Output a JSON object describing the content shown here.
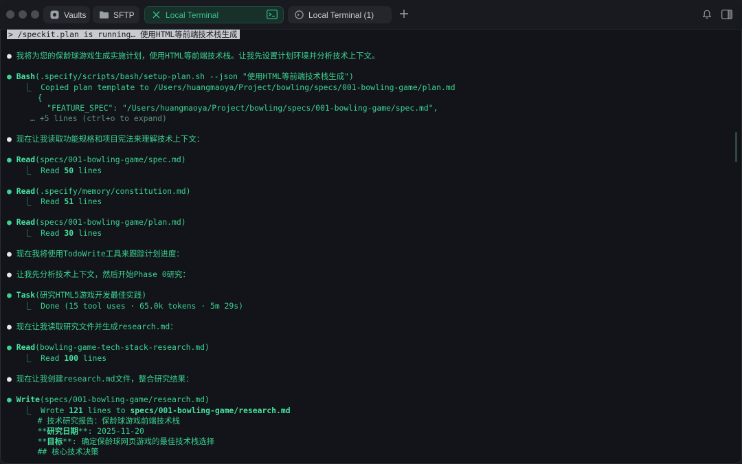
{
  "tabs": [
    {
      "label": "Vaults",
      "icon": "vault-icon"
    },
    {
      "label": "SFTP",
      "icon": "folder-icon"
    },
    {
      "label": "Local Terminal",
      "icon": "close-icon",
      "active": true
    },
    {
      "label": "Local Terminal (1)",
      "icon": "terminal-icon"
    }
  ],
  "terminal": {
    "prompt": "> /speckit.plan is running… 使用HTML等前端技术栈生成",
    "bullet": "●",
    "l1": "我将为您的保龄球游戏生成实施计划，使用HTML等前端技术栈。让我先设置计划环境并分析技术上下文。",
    "bash_name": "Bash",
    "bash_args": "(.specify/scripts/bash/setup-plan.sh --json \"使用HTML等前端技术栈生成\")",
    "bash_out1": "⎿  Copied plan template to /Users/huangmaoya/Project/bowling/specs/001-bowling-game/plan.md",
    "bash_out2": "   {",
    "bash_out3": "     \"FEATURE_SPEC\": \"/Users/huangmaoya/Project/bowling/specs/001-bowling-game/spec.md\",",
    "bash_out4": "… +5 lines (ctrl+o to expand)",
    "l2": "现在让我读取功能规格和项目宪法来理解技术上下文：",
    "read1_name": "Read",
    "read1_args": "(specs/001-bowling-game/spec.md)",
    "read1_pre": "⎿  Read ",
    "read1_count": "50",
    "read1_post": " lines",
    "read2_name": "Read",
    "read2_args": "(.specify/memory/constitution.md)",
    "read2_pre": "⎿  Read ",
    "read2_count": "51",
    "read2_post": " lines",
    "read3_name": "Read",
    "read3_args": "(specs/001-bowling-game/plan.md)",
    "read3_pre": "⎿  Read ",
    "read3_count": "30",
    "read3_post": " lines",
    "l3": "现在我将使用TodoWrite工具来跟踪计划进度：",
    "l4": "让我先分析技术上下文，然后开始Phase 0研究：",
    "task_name": "Task",
    "task_args": "(研究HTML5游戏开发最佳实践)",
    "task_out": "⎿  Done (15 tool uses · 65.0k tokens · 5m 29s)",
    "l5": "现在让我读取研究文件并生成research.md：",
    "read4_name": "Read",
    "read4_args": "(bowling-game-tech-stack-research.md)",
    "read4_pre": "⎿  Read ",
    "read4_count": "100",
    "read4_post": " lines",
    "l6": "现在让我创建research.md文件，整合研究结果：",
    "write_name": "Write",
    "write_args": "(specs/001-bowling-game/research.md)",
    "write_pre": "⎿  Wrote ",
    "write_count": "121",
    "write_mid": " lines to ",
    "write_path": "specs/001-bowling-game/research.md",
    "w1": "   # 技术研究报告：保龄球游戏前端技术栈",
    "w2a": "   **",
    "w2b": "研究日期",
    "w2c": "**: 2025-11-20",
    "w3a": "   **",
    "w3b": "目标",
    "w3c": "**: 确定保龄球网页游戏的最佳技术栈选择",
    "w4": "   ## 核心技术决策"
  }
}
